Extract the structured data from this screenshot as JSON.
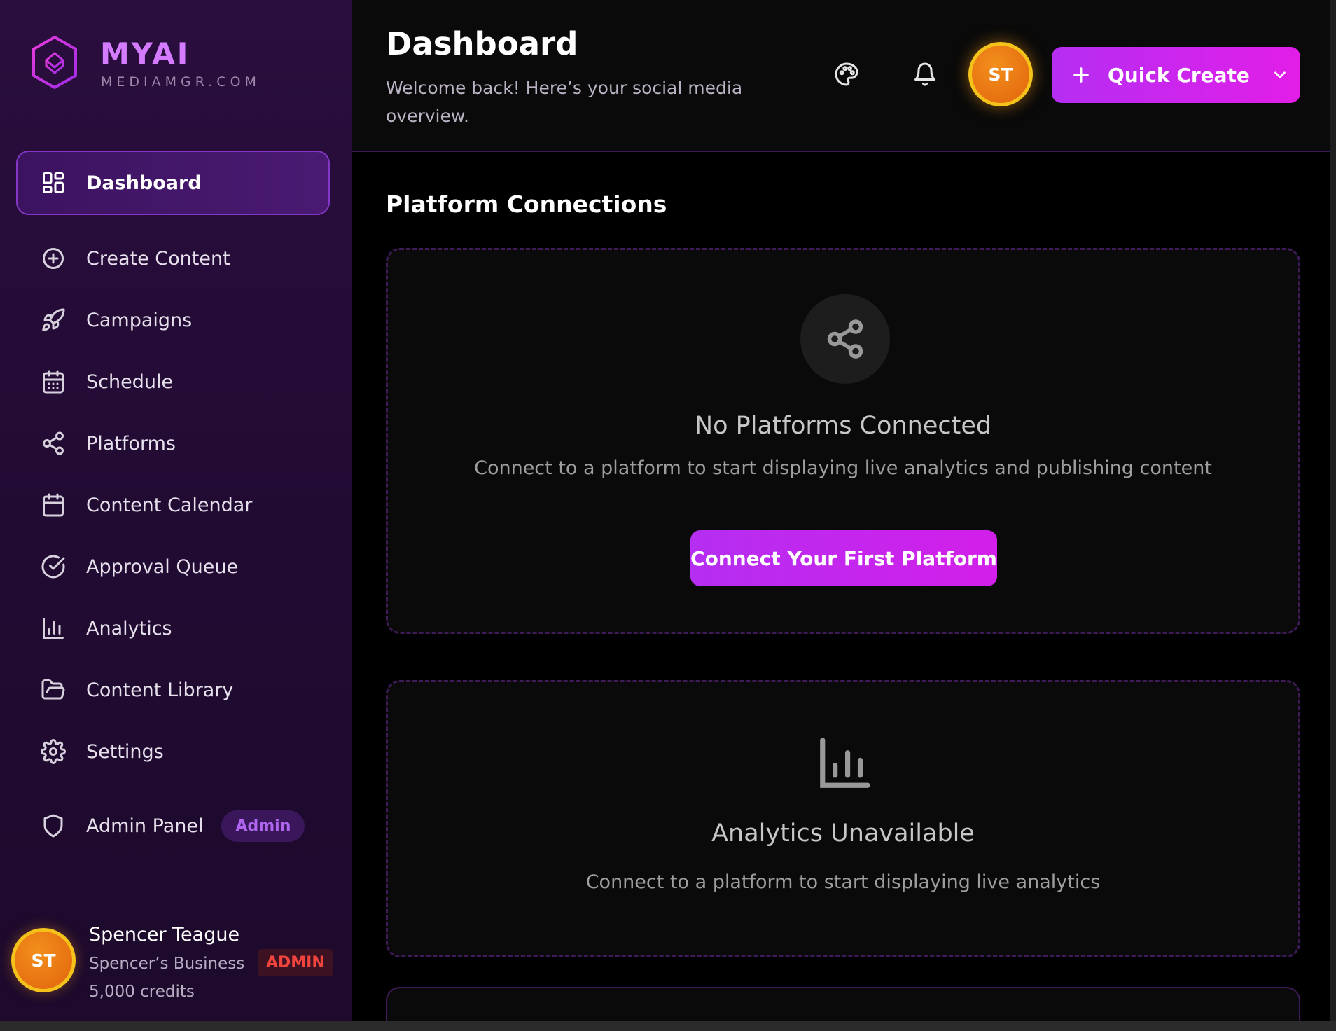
{
  "brand": {
    "name": "MYAI",
    "subtitle": "MEDIAMGR.COM",
    "accent": "#d57bff"
  },
  "nav": {
    "items": [
      {
        "label": "Dashboard",
        "icon": "grid-icon",
        "active": true
      },
      {
        "label": "Create Content",
        "icon": "plus-circle-icon"
      },
      {
        "label": "Campaigns",
        "icon": "rocket-icon"
      },
      {
        "label": "Schedule",
        "icon": "calendar-grid-icon"
      },
      {
        "label": "Platforms",
        "icon": "share-icon"
      },
      {
        "label": "Content Calendar",
        "icon": "calendar-icon"
      },
      {
        "label": "Approval Queue",
        "icon": "check-circle-icon"
      },
      {
        "label": "Analytics",
        "icon": "bar-chart-icon"
      },
      {
        "label": "Content Library",
        "icon": "folder-icon"
      },
      {
        "label": "Settings",
        "icon": "gear-icon"
      }
    ],
    "admin": {
      "label": "Admin Panel",
      "badge": "Admin",
      "icon": "shield-icon"
    }
  },
  "user": {
    "initials": "ST",
    "name": "Spencer Teague",
    "business": "Spencer’s Business",
    "role": "ADMIN",
    "credits": "5,000 credits"
  },
  "header": {
    "title": "Dashboard",
    "subtitle": "Welcome back! Here’s your social media overview.",
    "avatar_initials": "ST",
    "quick_create_label": "Quick Create",
    "icons": [
      "palette-icon",
      "bell-icon"
    ]
  },
  "platform_section": {
    "title": "Platform Connections",
    "empty_title": "No Platforms Connected",
    "empty_text": "Connect to a platform to start displaying live analytics and publishing content",
    "button_label": "Connect Your First Platform"
  },
  "analytics_section": {
    "title": "Analytics Unavailable",
    "text": "Connect to a platform to start displaying live analytics"
  },
  "colors": {
    "primary_gradient_start": "#b52ef2",
    "primary_gradient_end": "#e21ee8",
    "avatar_orange": "#e9770f",
    "avatar_ring": "#f4c21b",
    "role_red": "#f0443d"
  }
}
